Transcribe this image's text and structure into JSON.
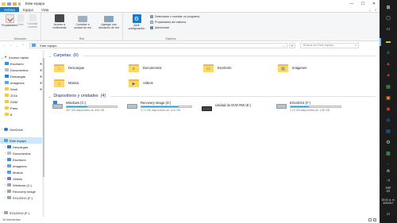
{
  "window": {
    "title": "Este equipo",
    "controls": {
      "minimize": "—",
      "maximize": "☐",
      "close": "✕"
    }
  },
  "ribbon": {
    "tabs": [
      "Archivo",
      "Equipo",
      "Vista"
    ],
    "help": "?",
    "groups": {
      "location": {
        "label": "Ubicación",
        "buttons": [
          "Propiedades",
          "Abrir",
          "Cambiar nombre"
        ]
      },
      "network": {
        "label": "Red",
        "buttons": [
          "Acceso a multimedia",
          "Conectar a unidad de red",
          "Agregar una ubicación de red"
        ]
      },
      "system": {
        "label": "Sistema",
        "open_settings": "Abrir configuración",
        "items": [
          "Desinstalar o cambiar un programa",
          "Propiedades del sistema",
          "Administrar"
        ]
      }
    }
  },
  "address": {
    "path": "Este equipo",
    "search_placeholder": "Buscar en Este equipo"
  },
  "nav": {
    "items": [
      {
        "label": "Acceso rápido",
        "chev": "⌄"
      },
      {
        "label": "Escritorio",
        "pin": "✱"
      },
      {
        "label": "Documentos",
        "pin": "✱"
      },
      {
        "label": "Descargas",
        "pin": "✱"
      },
      {
        "label": "Imágenes",
        "pin": "✱"
      },
      {
        "label": "Work",
        "pin": "✱"
      },
      {
        "label": "2016"
      },
      {
        "label": "GAM"
      },
      {
        "label": "Paris"
      },
      {
        "label": "8"
      },
      {
        "label": "OneDrive",
        "chev": "›"
      },
      {
        "label": "Este equipo",
        "chev": "⌄"
      },
      {
        "label": "Descargas",
        "chev": "›"
      },
      {
        "label": "Documentos",
        "chev": "›"
      },
      {
        "label": "Escritorio",
        "chev": "›"
      },
      {
        "label": "Imágenes",
        "chev": "›"
      },
      {
        "label": "Música",
        "chev": "›"
      },
      {
        "label": "Videos",
        "chev": "›"
      },
      {
        "label": "Windows (C:)",
        "chev": "›"
      },
      {
        "label": "Recovery image",
        "chev": "›"
      },
      {
        "label": "EGU2014 (F:)",
        "chev": "›"
      },
      {
        "label": "EGU2014 (F:)",
        "chev": "›"
      }
    ]
  },
  "content": {
    "folders_header": "Carpetas",
    "folders_count": "(6)",
    "folders": [
      {
        "label": "Descargas",
        "glyph": "↓"
      },
      {
        "label": "Documentos",
        "glyph": "≡"
      },
      {
        "label": "Escritorio",
        "glyph": "▭"
      },
      {
        "label": "Imágenes",
        "glyph": "▨"
      },
      {
        "label": "Música",
        "glyph": "♪"
      },
      {
        "label": "Videos",
        "glyph": "▶"
      }
    ],
    "devices_header": "Dispositivos y unidades",
    "devices_count": "(4)",
    "drives": [
      {
        "name": "Windows (C:)",
        "free": "267 GB disponibles de 449 GB",
        "used_fraction": 0.41
      },
      {
        "name": "Recovery image (D:)",
        "free": "3,73 GB disponibles de 14,8 GB",
        "used_fraction": 0.75
      },
      {
        "name": "Unidad de DVD RW (E:)"
      },
      {
        "name": "EGU2014 (F:)",
        "free": "1,19 GB disponibles de 1,85 GB",
        "used_fraction": 0.36
      }
    ]
  },
  "status": {
    "items": "10 elementos"
  },
  "taskbar": {
    "lang": "ESP",
    "region": "ES",
    "time": "10:41 a. m.",
    "date": "3/3/2017"
  },
  "colors": {
    "accent": "#1979ca",
    "folder": "#ffd766",
    "bar_fill": "#26a0da",
    "taskbar": "#1c1c1c",
    "selection": "#cce8ff"
  }
}
